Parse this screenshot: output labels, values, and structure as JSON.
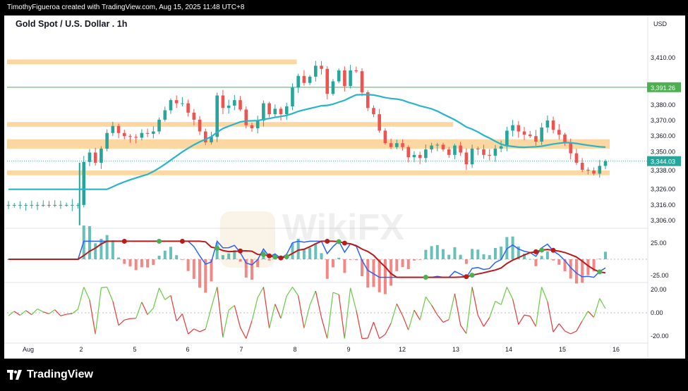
{
  "header": {
    "credit": "TimothyFigueroa created with TradingView.com, Aug 15, 2025 11:48 UTC+8",
    "symbol_title": "Gold Spot / U.S. Dollar . 1h",
    "currency": "USD"
  },
  "footer": {
    "brand": "TradingView"
  },
  "watermark": "WikiFX",
  "colors": {
    "bull": "#26a69a",
    "bear": "#ef5350",
    "ma": "#26b5c9",
    "zone": "#fcd7a1",
    "level_line": "#4caf50",
    "macd_line": "#2962ff",
    "signal_up": "#4caf50",
    "signal_down": "#b71c1c",
    "osc_up": "#66cc44",
    "osc_down": "#e53935"
  },
  "chart_data": [
    {
      "type": "candlestick",
      "title": "Gold Spot / U.S. Dollar . 1h",
      "x_ticks": [
        "Aug",
        "2",
        "5",
        "6",
        "7",
        "8",
        "9",
        "12",
        "13",
        "14",
        "15",
        "16"
      ],
      "y_ticks": [
        "3,410.00",
        "3,380.00",
        "3,370.00",
        "3,360.00",
        "3,350.00",
        "3,338.00",
        "3,326.00",
        "3,316.00",
        "3,306.00"
      ],
      "ylim": [
        3302,
        3420
      ],
      "last_price": "3,344.03",
      "level_label": "3,391.26",
      "support_resistance_zones": [
        {
          "low": 3406,
          "high": 3409,
          "x_end": 49
        },
        {
          "low": 3366,
          "high": 3369,
          "x_end": 76
        },
        {
          "low": 3352,
          "high": 3358,
          "x_end": 103
        },
        {
          "low": 3335,
          "high": 3338,
          "x_end": 103
        }
      ],
      "closes": [
        3316.0,
        3316.0,
        3316.0,
        3316.0,
        3316.0,
        3316.0,
        3316.0,
        3316.0,
        3316.0,
        3316.0,
        3316.0,
        3316.0,
        3316.0,
        3343.5,
        3349.5,
        3343.0,
        3352.0,
        3362.0,
        3366.5,
        3362.0,
        3360.0,
        3359.5,
        3359.0,
        3362.0,
        3361.5,
        3363.0,
        3370.5,
        3376.5,
        3383.0,
        3381.0,
        3381.0,
        3375.0,
        3370.5,
        3363.0,
        3356.0,
        3359.5,
        3386.0,
        3378.0,
        3379.5,
        3383.0,
        3377.0,
        3367.0,
        3365.0,
        3370.0,
        3381.0,
        3374.0,
        3377.5,
        3374.0,
        3379.0,
        3391.0,
        3398.5,
        3394.0,
        3398.0,
        3405.0,
        3403.0,
        3387.0,
        3395.0,
        3402.0,
        3392.0,
        3402.0,
        3401.5,
        3388.0,
        3378.0,
        3374.0,
        3363.5,
        3355.5,
        3353.0,
        3355.5,
        3353.0,
        3346.5,
        3348.0,
        3346.0,
        3351.5,
        3354.0,
        3354.5,
        3351.5,
        3348.0,
        3354.0,
        3349.5,
        3342.0,
        3352.0,
        3351.5,
        3348.0,
        3347.5,
        3352.0,
        3353.5,
        3363.5,
        3367.0,
        3363.0,
        3361.0,
        3360.0,
        3356.5,
        3365.5,
        3370.0,
        3364.0,
        3361.0,
        3356.0,
        3349.0,
        3343.0,
        3338.5,
        3338.0,
        3336.0,
        3341.0,
        3344.0
      ]
    },
    {
      "type": "line",
      "y_ticks": [
        "25.00",
        "-25.00"
      ],
      "ylim": [
        -40,
        40
      ]
    },
    {
      "type": "line",
      "y_ticks": [
        "20.00",
        "0.00",
        "-20.00"
      ],
      "ylim": [
        -25,
        25
      ]
    }
  ]
}
